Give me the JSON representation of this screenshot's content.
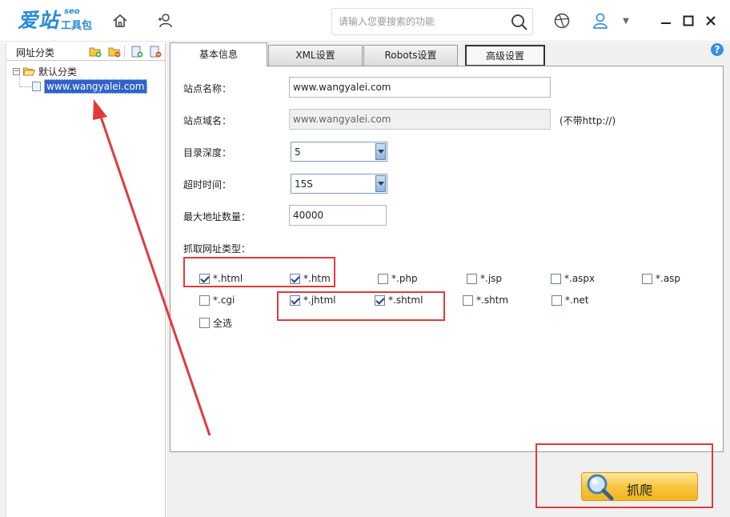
{
  "app": {
    "logo_main": "爱站",
    "logo_sub": "工具包",
    "logo_seo": "seo"
  },
  "search": {
    "placeholder": "请输入您要搜索的功能"
  },
  "left_panel": {
    "title": "网址分类",
    "tree": [
      {
        "label": "默认分类",
        "expanded": true
      },
      {
        "label": "www.wangyalei.com",
        "selected": true
      }
    ]
  },
  "tabs": [
    {
      "label": "基本信息",
      "active": true
    },
    {
      "label": "XML设置",
      "active": false
    },
    {
      "label": "Robots设置",
      "active": false
    },
    {
      "label": "高级设置",
      "active": false
    }
  ],
  "form": {
    "site_name_label": "站点名称：",
    "site_name_value": "www.wangyalei.com",
    "site_domain_label": "站点域名：",
    "site_domain_value": "www.wangyalei.com",
    "site_domain_note": "(不带http://)",
    "depth_label": "目录深度：",
    "depth_value": "5",
    "timeout_label": "超时时间：",
    "timeout_value": "15S",
    "max_urls_label": "最大地址数量：",
    "max_urls_value": "40000",
    "url_types_label": "抓取网址类型："
  },
  "url_types": [
    {
      "label": "*.html",
      "checked": true
    },
    {
      "label": "*.htm",
      "checked": true
    },
    {
      "label": "*.php",
      "checked": false
    },
    {
      "label": "*.jsp",
      "checked": false
    },
    {
      "label": "*.aspx",
      "checked": false
    },
    {
      "label": "*.asp",
      "checked": false
    },
    {
      "label": "*.cgi",
      "checked": false
    },
    {
      "label": "*.jhtml",
      "checked": true
    },
    {
      "label": "*.shtml",
      "checked": true
    },
    {
      "label": "*.shtm",
      "checked": false
    },
    {
      "label": "*.net",
      "checked": false
    },
    {
      "label": "全选",
      "checked": false
    }
  ],
  "crawl_button": {
    "label": "抓爬"
  },
  "colors": {
    "accent": "#2a8ad4",
    "annotation_red": "#e03b3b",
    "selection": "#3162c9"
  },
  "icons": [
    "home-icon",
    "user-switch-icon",
    "search-icon",
    "globe-icon",
    "user-icon",
    "help-icon",
    "magnifier-icon"
  ]
}
